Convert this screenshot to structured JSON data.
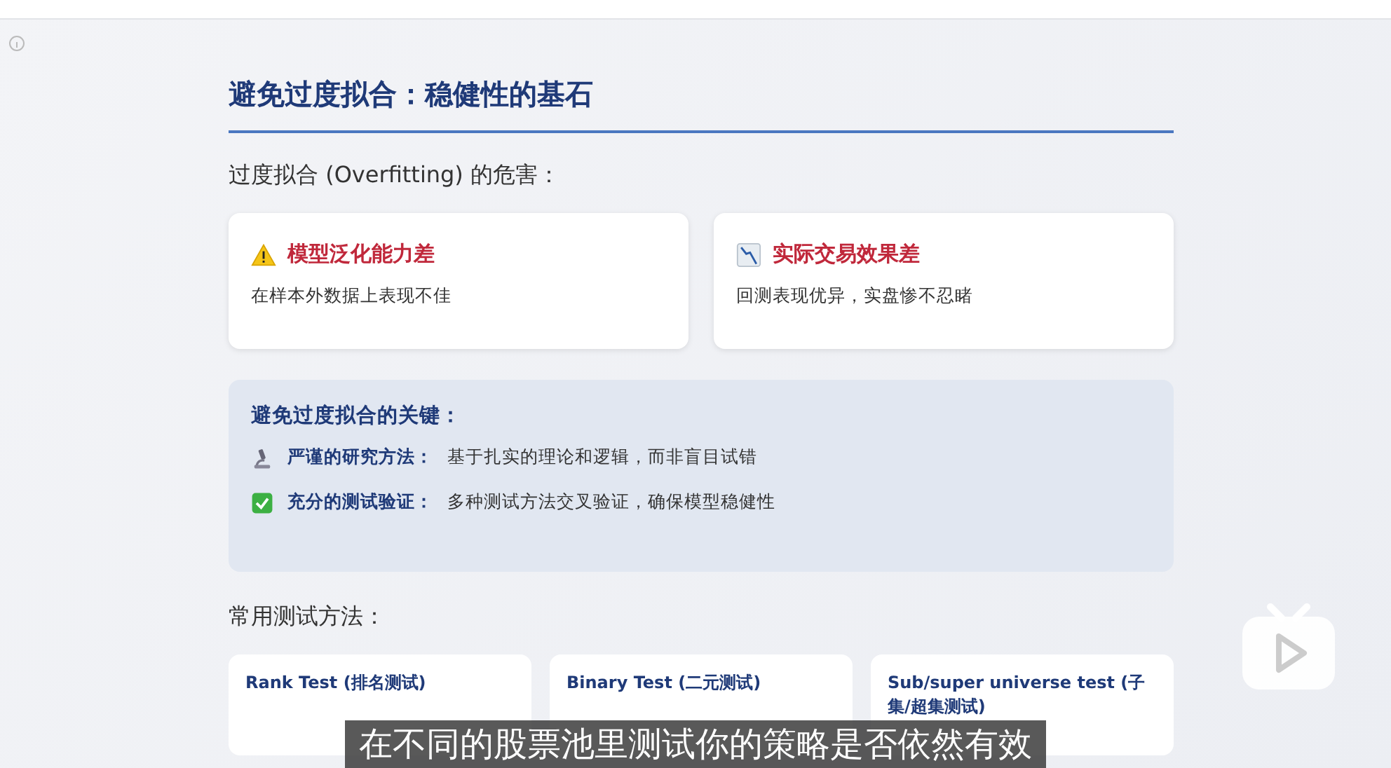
{
  "slide": {
    "title": "避免过度拟合：稳健性的基石",
    "subtitle": "过度拟合 (Overfitting) 的危害：",
    "harms": [
      {
        "kind": "warning",
        "title": "模型泛化能力差",
        "text": "在样本外数据上表现不佳"
      },
      {
        "kind": "decline",
        "title": "实际交易效果差",
        "text": "回测表现优异，实盘惨不忍睹"
      }
    ],
    "keys": {
      "title": "避免过度拟合的关键：",
      "items": [
        {
          "kind": "microscope",
          "label": "严谨的研究方法：",
          "text": "基于扎实的理论和逻辑，而非盲目试错"
        },
        {
          "kind": "check",
          "label": "充分的测试验证：",
          "text": "多种测试方法交叉验证，确保模型稳健性"
        }
      ]
    },
    "methods_title": "常用测试方法：",
    "methods": [
      {
        "title": "Rank Test (排名测试)"
      },
      {
        "title": "Binary Test (二元测试)"
      },
      {
        "title": "Sub/super universe test (子集/超集测试)"
      }
    ]
  },
  "caption": "在不同的股票池里测试你的策略是否依然有效"
}
